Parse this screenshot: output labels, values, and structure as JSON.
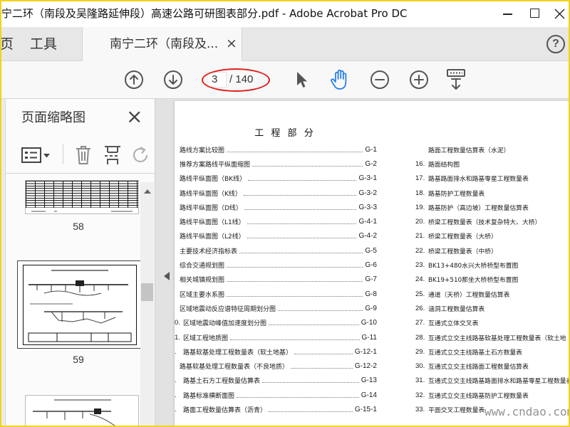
{
  "window": {
    "title": "宁二环（南段及吴隆路延伸段）高速公路可研图表部分.pdf - Adobe Acrobat Pro DC"
  },
  "tabs": {
    "home_label": "页",
    "tools_label": "工具",
    "document_label": "南宁二环（南段及...",
    "close_glyph": "×",
    "help_glyph": "?"
  },
  "toolbar": {
    "page_current": "3",
    "page_total": "/ 140"
  },
  "icons": {
    "window": [
      "minimize-icon",
      "maximize-icon",
      "close-window-icon"
    ],
    "toolbar": [
      "previous-page-icon",
      "next-page-icon",
      "select-cursor-icon",
      "hand-tool-icon",
      "zoom-out-icon",
      "zoom-in-icon",
      "scroll-mode-icon"
    ],
    "panel": [
      "thumbnail-options-icon",
      "dropdown-caret-icon",
      "delete-page-icon",
      "insert-pages-icon",
      "rotate-page-icon"
    ],
    "main": [
      "collapse-panel-icon"
    ]
  },
  "colors": {
    "accent": "#2680eb",
    "annotation_ellipse": "#e0201c",
    "frame": "#f3d21b"
  },
  "thumbnails_panel": {
    "title": "页面缩略图",
    "close_glyph": "×",
    "pages": [
      {
        "label": "58",
        "selected": false
      },
      {
        "label": "59",
        "selected": true
      }
    ]
  },
  "document": {
    "heading": "工 程 部 分",
    "left_entries": [
      {
        "number": "",
        "title": "路线方案比较图",
        "code": "G-1"
      },
      {
        "number": "",
        "title": "推荐方案路线平纵面缩图",
        "code": "G-2"
      },
      {
        "number": "",
        "title": "路线平纵面图（BK线）",
        "code": "G-3-1"
      },
      {
        "number": "",
        "title": "路线平纵面图（K线）",
        "code": "G-3-2"
      },
      {
        "number": "",
        "title": "路线平纵面图（D线）",
        "code": "G-3-3"
      },
      {
        "number": "",
        "title": "路线平纵面图（L1线）",
        "code": "G-4-1"
      },
      {
        "number": "",
        "title": "路线平纵面图（L2线）",
        "code": "G-4-2"
      },
      {
        "number": "",
        "title": "主要技术经济指标表",
        "code": "G-5"
      },
      {
        "number": "",
        "title": "综合交通规划图",
        "code": "G-6"
      },
      {
        "number": "",
        "title": "相关城镇规划图",
        "code": "G-7"
      },
      {
        "number": "",
        "title": "区域主要水系图",
        "code": "G-8"
      },
      {
        "number": "",
        "title": "区域地震动反应谱特征周期划分图",
        "code": "G-9"
      },
      {
        "number": "0.",
        "title": "区域地震动峰值加速度划分图",
        "code": "G-10"
      },
      {
        "number": "1.",
        "title": "区域工程地质图",
        "code": "G-11"
      },
      {
        "number": ".",
        "title": "路基软基处理工程数量表（软土地基）",
        "code": "G-12-1"
      },
      {
        "number": "",
        "title": "路基软基处理工程数量表（不良地质）",
        "code": "G-12-2"
      },
      {
        "number": ".",
        "title": "路基土石方工程数量估算表",
        "code": "G-13"
      },
      {
        "number": ".",
        "title": "路基标准横断面图",
        "code": "G-14"
      },
      {
        "number": ".",
        "title": "路面工程数量估算表（沥青）",
        "code": "G-15-1"
      }
    ],
    "right_entries": [
      {
        "number": "",
        "title": "路面工程数量估算表（水泥）"
      },
      {
        "number": "16.",
        "title": "路面结构图"
      },
      {
        "number": "17.",
        "title": "路基路面排水和路基零星工程数量表"
      },
      {
        "number": "18.",
        "title": "路基防护工程数量表"
      },
      {
        "number": "19.",
        "title": "路基防护（高边坡）工程数量估算表"
      },
      {
        "number": "20.",
        "title": "桥梁工程数量表（技术复杂特大、大桥）"
      },
      {
        "number": "21.",
        "title": "桥梁工程数量表（大桥）"
      },
      {
        "number": "22.",
        "title": "桥梁工程数量表（中桥）"
      },
      {
        "number": "23.",
        "title": "BK13+480水兴大桥桥型布置图"
      },
      {
        "number": "24.",
        "title": "BK19+510那坐大桥桥型布置图"
      },
      {
        "number": "25.",
        "title": "通道（天桥）工程数量估算表"
      },
      {
        "number": "26.",
        "title": "涵洞工程数量估算表"
      },
      {
        "number": "27.",
        "title": "互通式立体交叉表"
      },
      {
        "number": "28.",
        "title": "互通式立交主线路基软基处理工程数量表（软土地"
      },
      {
        "number": "29.",
        "title": "互通式立交主线路基土石方数量表"
      },
      {
        "number": "30.",
        "title": "互通式立交主线路面工程数量估算表"
      },
      {
        "number": "31.",
        "title": "互通式立交主线路基路面排水和路基零星工程数量表"
      },
      {
        "number": "32.",
        "title": "互通式立交主线路基防护工程数量表"
      },
      {
        "number": "33.",
        "title": "平面交叉工程数量表"
      }
    ]
  },
  "watermark": "www.cndao.com"
}
